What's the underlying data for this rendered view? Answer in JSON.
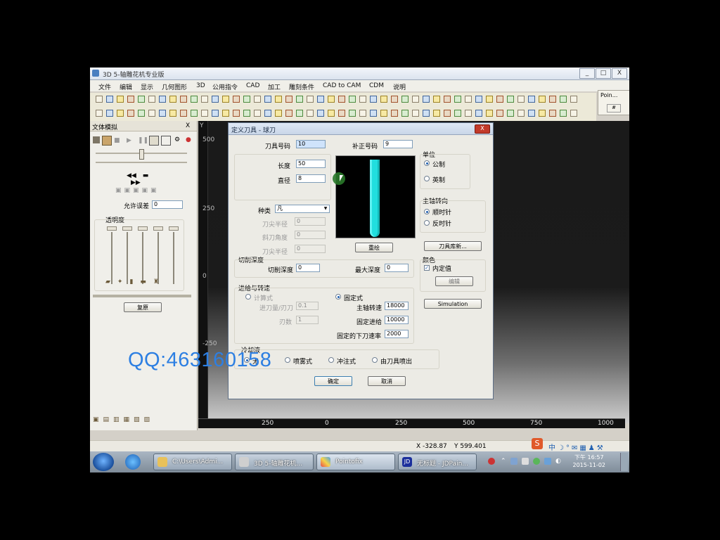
{
  "window": {
    "title": "3D 5-轴雕花机专业版",
    "controls": [
      "_",
      "□",
      "X"
    ]
  },
  "menu": [
    "文件",
    "编辑",
    "显示",
    "几何图形",
    "3D",
    "公用指令",
    "CAD",
    "加工",
    "雕刻条件",
    "CAD to CAM",
    "CDM",
    "说明"
  ],
  "pointo_label": "Poin...",
  "left_panel": {
    "title": "文体模拟",
    "close": "X",
    "tolerance_label": "允许误差",
    "tolerance_value": "0",
    "transparency_label": "透明度",
    "reset_button": "复原"
  },
  "viewport": {
    "y_labels": [
      "500",
      "250",
      "0",
      "-250"
    ],
    "x_labels": [
      "250",
      "0",
      "250",
      "500",
      "750",
      "1000"
    ]
  },
  "dialog": {
    "title": "定义刀具 - 球刀",
    "close": "X",
    "tool_no_label": "刀具号码",
    "tool_no_value": "10",
    "comp_no_label": "补正号码",
    "comp_no_value": "9",
    "length_label": "长度",
    "length_value": "50",
    "diameter_label": "直径",
    "diameter_value": "8",
    "type_label": "种类",
    "type_value": "凡",
    "tip_radius_label": "刀尖半径",
    "tip_radius_value": "0",
    "taper_angle_label": "斜刀角度",
    "taper_angle_value": "0",
    "tip_radius2_label": "刀尖半径",
    "tip_radius2_value": "0",
    "redraw_button": "重绘",
    "unit_group": "单位",
    "unit_metric": "公制",
    "unit_imperial": "英制",
    "spindle_group": "主轴转向",
    "spindle_cw": "顺时针",
    "spindle_ccw": "反时针",
    "library_button": "刀具库新...",
    "color_group": "颜色",
    "color_default": "内定值",
    "edit_button": "编辑",
    "simulation_button": "Simulation",
    "depth_group": "切削深度",
    "cut_depth_label": "切削深度",
    "cut_depth_value": "0",
    "max_depth_label": "最大深度",
    "max_depth_value": "0",
    "feed_group": "进给与转速",
    "calc_label": "计算式",
    "fixed_label": "固定式",
    "feed_per_tooth_label": "进刀量/刃刀",
    "feed_per_tooth_value": "0.1",
    "flutes_label": "刃数",
    "flutes_value": "1",
    "spindle_speed_label": "主轴转速",
    "spindle_speed_value": "18000",
    "fixed_feed_label": "固定进给",
    "fixed_feed_value": "10000",
    "plunge_label": "固定的下刀速率",
    "plunge_value": "2000",
    "coolant_group": "冷却液",
    "coolant_none": "无",
    "coolant_mist": "喷雾式",
    "coolant_flood": "冲注式",
    "coolant_through": "由刀具喷出",
    "ok_button": "确定",
    "cancel_button": "取消"
  },
  "overlay_text": "QQ:463160158",
  "status": {
    "x": "X -328.87",
    "y": "Y 599.401"
  },
  "taskbar": {
    "tasks": [
      "C:\\Users\\Admi...",
      "3D 5-轴雕花机...",
      "Pointofix",
      "无标题 - JDPain..."
    ],
    "clock_time": "下午 16:57",
    "clock_date": "2015-11-02",
    "jd_badge": "JD"
  },
  "colors": {
    "tool_preview": "#21dede",
    "overlay": "#2d7fe2",
    "close_red": "#c23a2a"
  }
}
